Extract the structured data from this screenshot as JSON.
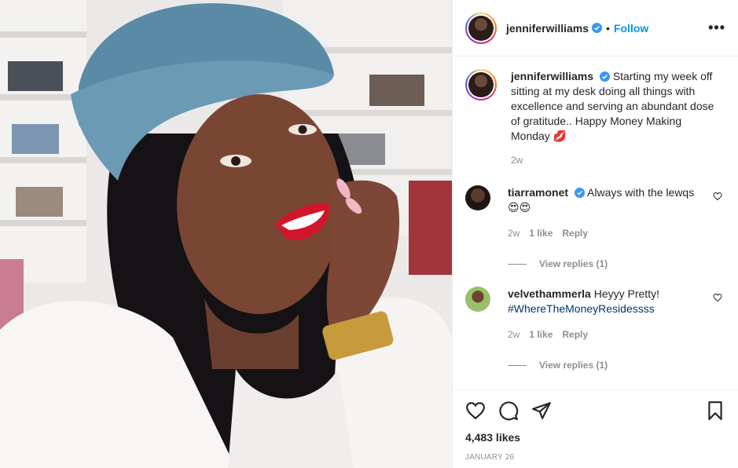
{
  "header": {
    "username": "jenniferwilliams",
    "separator": "•",
    "follow_label": "Follow",
    "more_label": "•••"
  },
  "caption": {
    "username": "jenniferwilliams",
    "text": "Starting my week off sitting at my desk doing all things with excellence and serving an abundant dose of gratitude.. Happy Money Making Monday 💋",
    "time": "2w"
  },
  "comments": [
    {
      "username": "tiarramonet",
      "text": "Always with the lewqs 😍😍",
      "time": "2w",
      "likes": "1 like",
      "reply_label": "Reply",
      "view_replies": "View replies (1)"
    },
    {
      "username": "velvethammerla",
      "text": "Heyyy Pretty!",
      "hashtag": "#WhereTheMoneyResidessss",
      "time": "2w",
      "likes": "1 like",
      "reply_label": "Reply",
      "view_replies": "View replies (1)"
    }
  ],
  "footer": {
    "likes": "4,483 likes",
    "date": "JANUARY 26"
  },
  "icons": {
    "verified": "verified-badge-icon",
    "like": "heart-icon",
    "comment": "comment-bubble-icon",
    "share": "paper-plane-icon",
    "save": "bookmark-icon"
  },
  "colors": {
    "accent": "#0095f6",
    "verified": "#3897f0",
    "muted": "#8e8e8e",
    "text": "#262626",
    "hashtag": "#00376b"
  }
}
